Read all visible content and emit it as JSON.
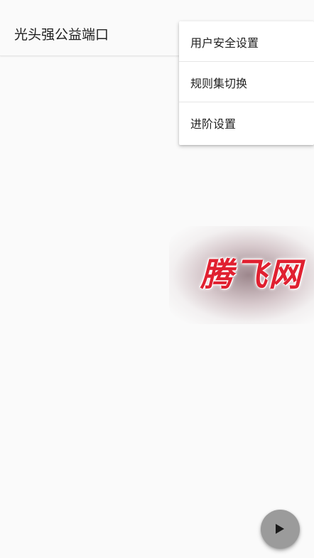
{
  "app_bar": {
    "title": "光头强公益端口"
  },
  "overflow_menu": {
    "items": [
      {
        "label": "用户安全设置"
      },
      {
        "label": "规则集切换"
      },
      {
        "label": "进阶设置"
      }
    ]
  },
  "watermark": {
    "text": "腾飞网"
  },
  "fab": {
    "icon": "play-icon"
  },
  "colors": {
    "background": "#fafafa",
    "menu_background": "#ffffff",
    "fab_background": "#9b9b9b",
    "watermark_text": "#e02030"
  }
}
